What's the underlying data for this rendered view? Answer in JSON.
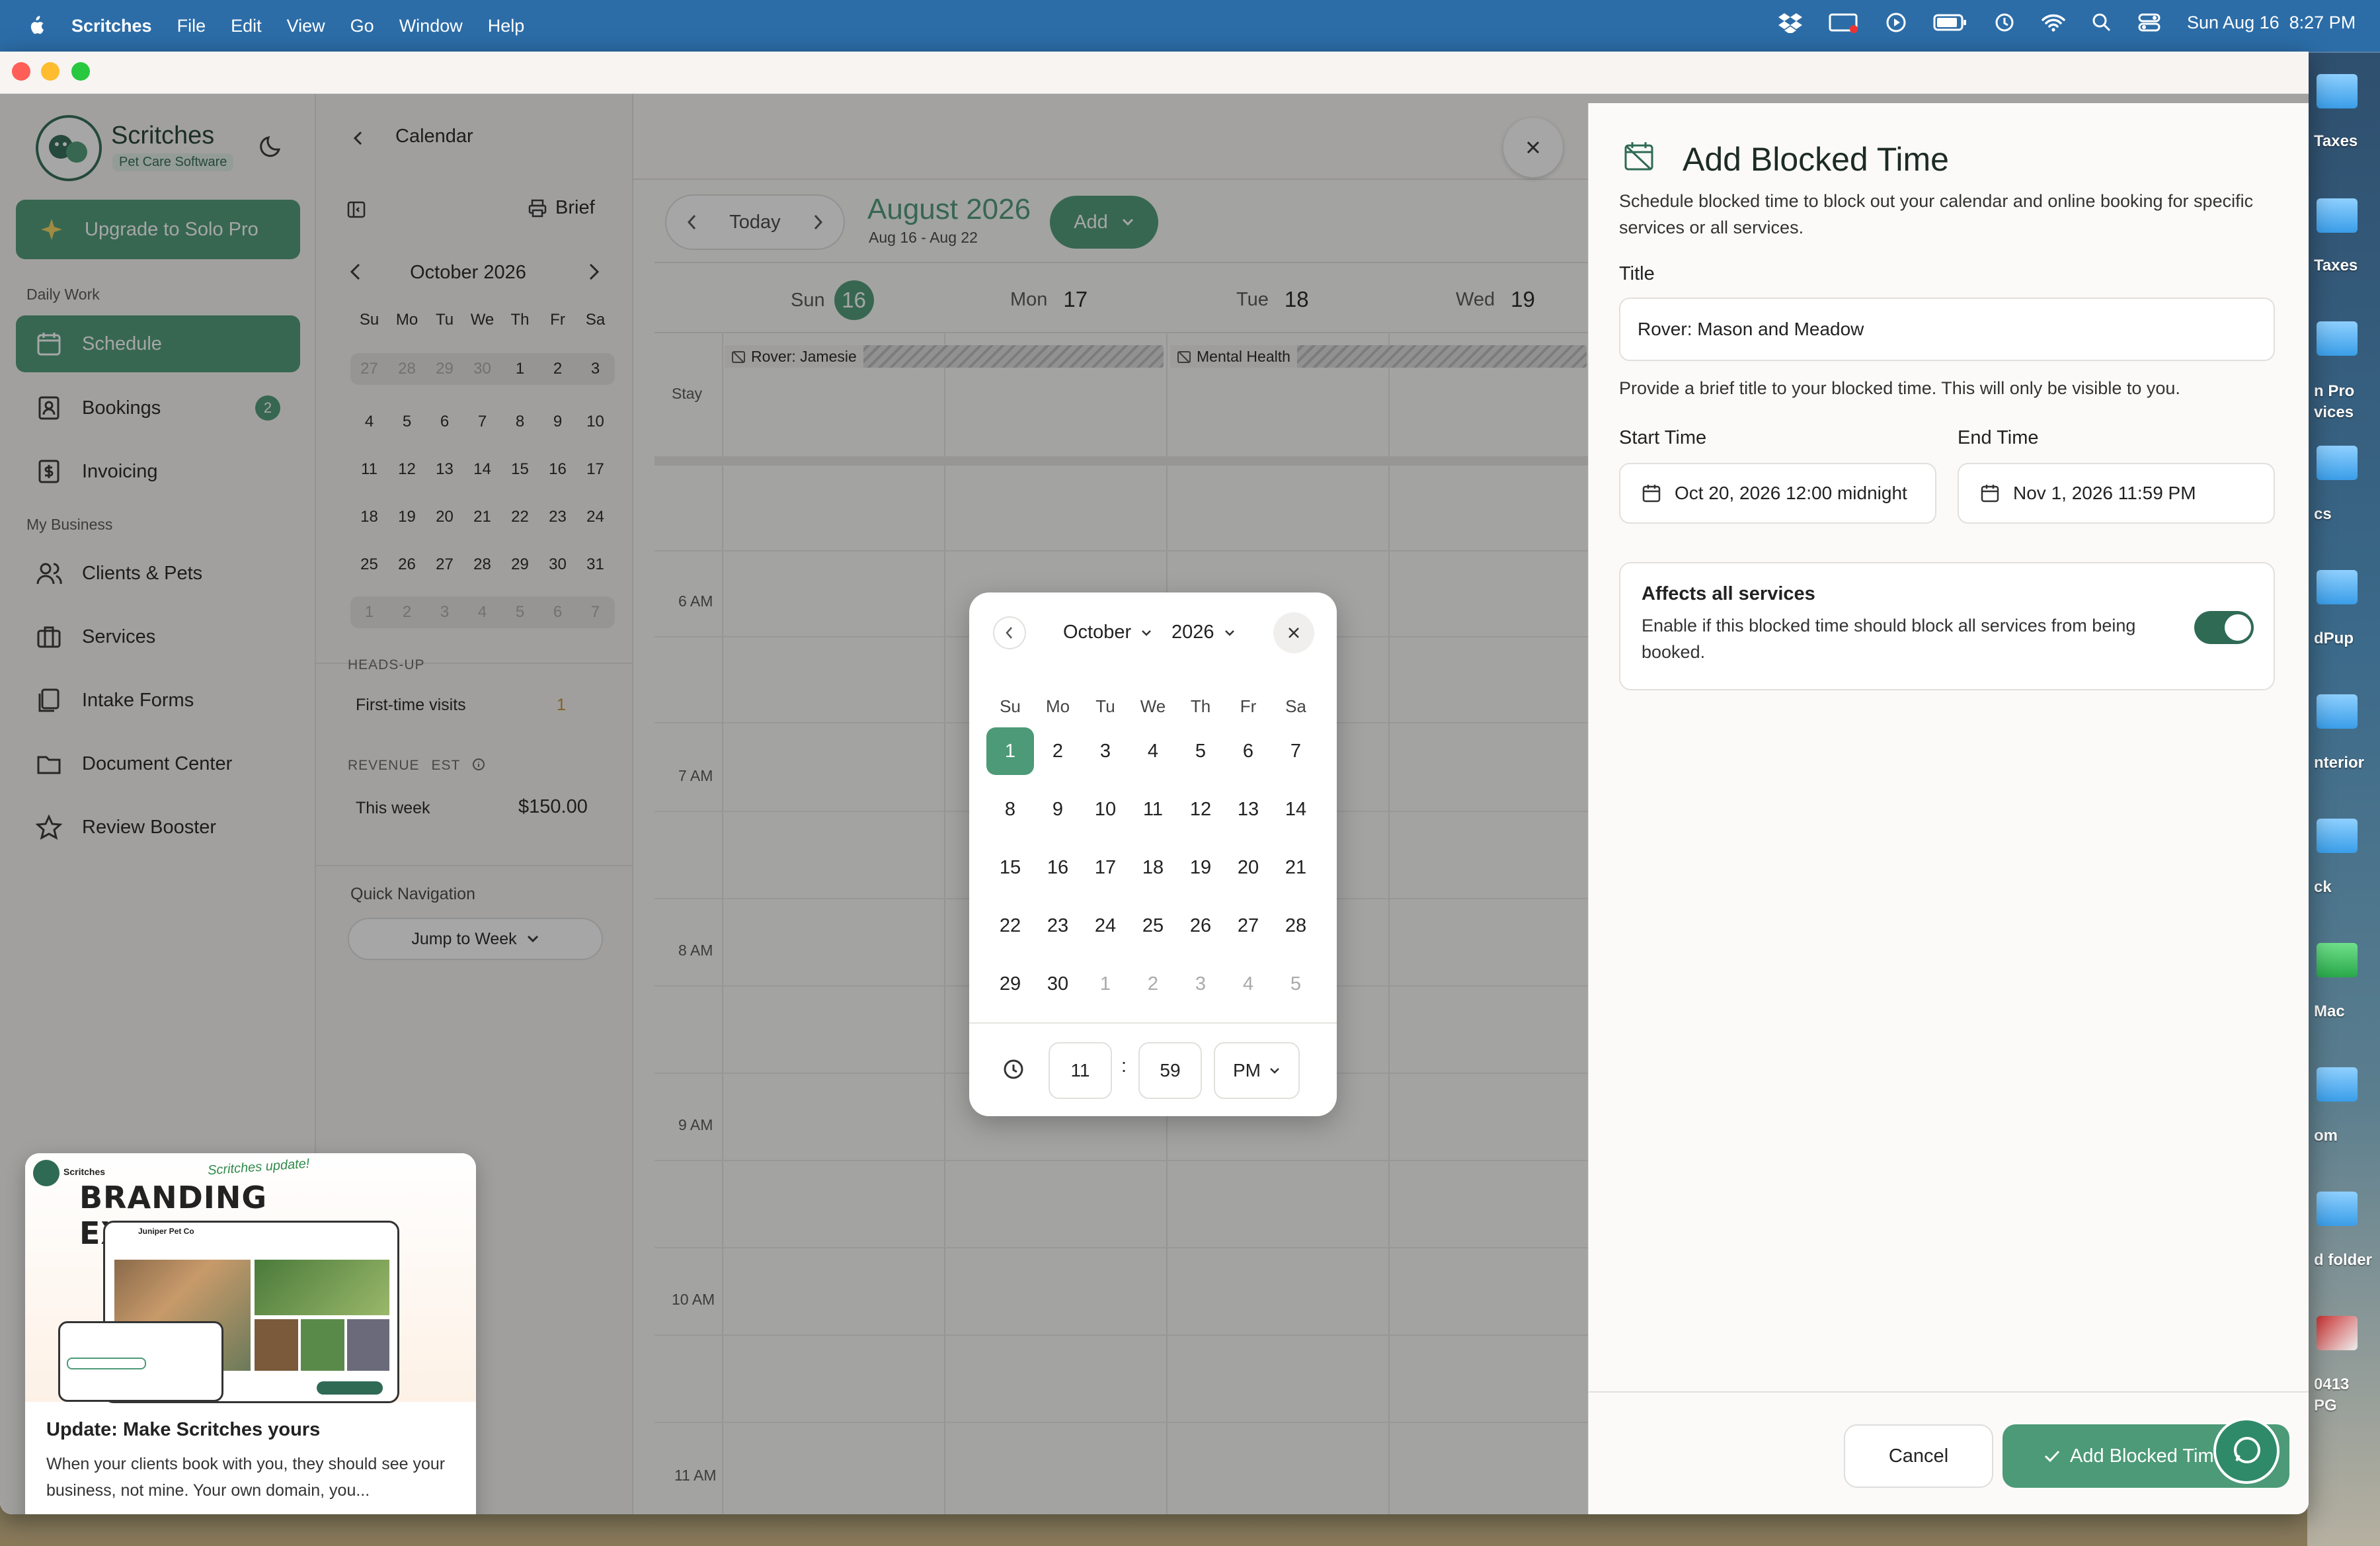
{
  "menubar": {
    "app": "Scritches",
    "items": [
      "File",
      "Edit",
      "View",
      "Go",
      "Window",
      "Help"
    ],
    "datetime": "Sun Aug 16  8:27 PM"
  },
  "desktop": {
    "labels": [
      "Taxes",
      "Taxes",
      "n Pro\nvices",
      "cs",
      "dPup",
      "nterior",
      "ck",
      "Mac",
      "om",
      "d folder",
      "0413\nPG"
    ]
  },
  "sidebar": {
    "brand": "Scritches",
    "brand_tag": "Pet Care Software",
    "upgrade": "Upgrade to Solo Pro",
    "section_daily": "Daily Work",
    "section_business": "My Business",
    "items": [
      {
        "label": "Schedule"
      },
      {
        "label": "Bookings",
        "badge": "2"
      },
      {
        "label": "Invoicing"
      },
      {
        "label": "Clients & Pets"
      },
      {
        "label": "Services"
      },
      {
        "label": "Intake Forms"
      },
      {
        "label": "Document Center"
      },
      {
        "label": "Review Booster"
      }
    ]
  },
  "promo": {
    "brand": "Scritches",
    "kicker": "Scritches update!",
    "headline": "BRANDING EXPANSION",
    "title": "Update: Make Scritches yours",
    "body": "When your clients book with you, they should see your business, not mine. Your own domain, you...",
    "mock_business": "Juniper Pet Co"
  },
  "header": {
    "back_label": "Calendar",
    "brief_label": "Brief"
  },
  "mini_calendar": {
    "month": "October 2026",
    "weekdays": [
      "Su",
      "Mo",
      "Tu",
      "We",
      "Th",
      "Fr",
      "Sa"
    ],
    "weeks": [
      [
        "27",
        "28",
        "29",
        "30",
        "1",
        "2",
        "3"
      ],
      [
        "4",
        "5",
        "6",
        "7",
        "8",
        "9",
        "10"
      ],
      [
        "11",
        "12",
        "13",
        "14",
        "15",
        "16",
        "17"
      ],
      [
        "18",
        "19",
        "20",
        "21",
        "22",
        "23",
        "24"
      ],
      [
        "25",
        "26",
        "27",
        "28",
        "29",
        "30",
        "31"
      ],
      [
        "1",
        "2",
        "3",
        "4",
        "5",
        "6",
        "7"
      ]
    ]
  },
  "heads_up": {
    "title": "HEADS-UP",
    "first_time_label": "First-time visits",
    "first_time_count": "1"
  },
  "revenue": {
    "title": "REVENUE",
    "est": "EST",
    "week_label": "This week",
    "week_value": "$150.00"
  },
  "quick_nav": {
    "title": "Quick Navigation",
    "jump_label": "Jump to Week"
  },
  "calendar": {
    "today_label": "Today",
    "month_title": "August 2026",
    "range": "Aug 16 - Aug 22",
    "add_label": "Add",
    "days": [
      {
        "name": "Sun",
        "num": "16"
      },
      {
        "name": "Mon",
        "num": "17"
      },
      {
        "name": "Tue",
        "num": "18"
      },
      {
        "name": "Wed",
        "num": "19"
      }
    ],
    "allday_label": "Stay",
    "events": [
      "Rover: Jamesie",
      "Mental Health"
    ],
    "hours": [
      "6 AM",
      "7 AM",
      "8 AM",
      "9 AM",
      "10 AM",
      "11 AM"
    ]
  },
  "panel": {
    "title": "Add Blocked Time",
    "description": "Schedule blocked time to block out your calendar and online booking for specific services or all services.",
    "title_label": "Title",
    "title_value": "Rover: Mason and Meadow",
    "title_hint": "Provide a brief title to your blocked time. This will only be visible to you.",
    "start_label": "Start Time",
    "start_value": "Oct 20, 2026 12:00 midnight",
    "end_label": "End Time",
    "end_value": "Nov 1, 2026 11:59 PM",
    "affects_title": "Affects all services",
    "affects_desc": "Enable if this blocked time should block all services from being booked.",
    "affects_on": true,
    "cancel": "Cancel",
    "submit": "Add Blocked Time"
  },
  "picker": {
    "month": "October",
    "year": "2026",
    "weekdays": [
      "Su",
      "Mo",
      "Tu",
      "We",
      "Th",
      "Fr",
      "Sa"
    ],
    "weeks": [
      [
        "1",
        "2",
        "3",
        "4",
        "5",
        "6",
        "7"
      ],
      [
        "8",
        "9",
        "10",
        "11",
        "12",
        "13",
        "14"
      ],
      [
        "15",
        "16",
        "17",
        "18",
        "19",
        "20",
        "21"
      ],
      [
        "22",
        "23",
        "24",
        "25",
        "26",
        "27",
        "28"
      ],
      [
        "29",
        "30",
        "1",
        "2",
        "3",
        "4",
        "5"
      ]
    ],
    "selected_day": "1",
    "hour": "11",
    "minute": "59",
    "ampm": "PM"
  },
  "colors": {
    "brand_green": "#4c9a77",
    "menubar_blue": "#2c6da8"
  }
}
